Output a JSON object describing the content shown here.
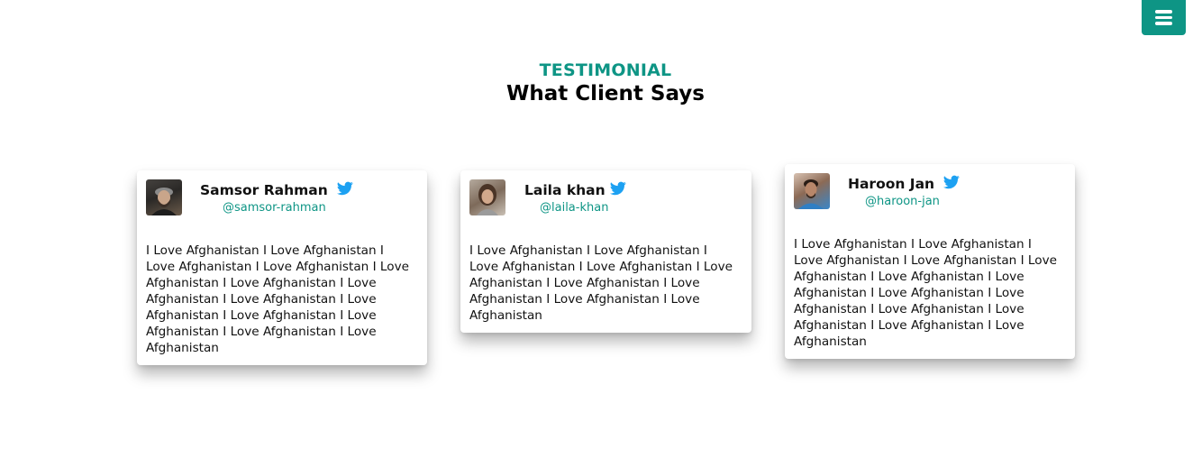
{
  "nav": {
    "menu_icon": "hamburger-menu-icon",
    "accent": "#0e9585"
  },
  "section": {
    "eyebrow": "TESTIMONIAL",
    "title": "What Client Says"
  },
  "testimonials": [
    {
      "name": "Samsor Rahman",
      "handle": "@samsor-rahman",
      "icon": "twitter-icon",
      "quote": "I Love Afghanistan I Love Afghanistan I Love Afghanistan I Love Afghanistan I Love Afghanistan I Love Afghanistan I Love Afghanistan I Love Afghanistan I Love Afghanistan I Love Afghanistan I Love Afghanistan I Love Afghanistan I Love Afghanistan"
    },
    {
      "name": "Laila khan",
      "handle": "@laila-khan",
      "icon": "twitter-icon",
      "quote": "I Love Afghanistan I Love Afghanistan I Love Afghanistan I Love Afghanistan I Love Afghanistan I Love Afghanistan I Love Afghanistan I Love Afghanistan I Love Afghanistan"
    },
    {
      "name": "Haroon Jan",
      "handle": "@haroon-jan",
      "icon": "twitter-icon",
      "quote": "I Love Afghanistan I Love Afghanistan I Love Afghanistan I Love Afghanistan I Love Afghanistan I Love Afghanistan I Love Afghanistan I Love Afghanistan I Love Afghanistan I Love Afghanistan I Love Afghanistan I Love Afghanistan I Love Afghanistan"
    }
  ],
  "colors": {
    "accent": "#0e9585",
    "twitter": "#1da1f2",
    "text": "#111111"
  }
}
